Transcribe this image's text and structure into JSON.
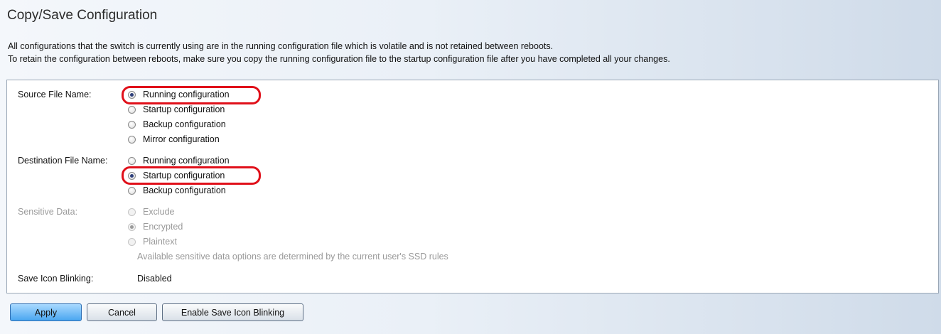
{
  "page": {
    "title": "Copy/Save Configuration",
    "intro_line1": "All configurations that the switch is currently using are in the running configuration file which is volatile and is not retained between reboots.",
    "intro_line2": "To retain the configuration between reboots, make sure you copy the running configuration file to the startup configuration file after you have completed all your changes."
  },
  "source": {
    "label": "Source File Name:",
    "options": [
      "Running configuration",
      "Startup configuration",
      "Backup configuration",
      "Mirror configuration"
    ],
    "selected": "Running configuration"
  },
  "destination": {
    "label": "Destination File Name:",
    "options": [
      "Running configuration",
      "Startup configuration",
      "Backup configuration"
    ],
    "selected": "Startup configuration"
  },
  "sensitive": {
    "label": "Sensitive Data:",
    "options": [
      "Exclude",
      "Encrypted",
      "Plaintext"
    ],
    "selected": "Encrypted",
    "note": "Available sensitive data options are determined by the current user's SSD rules"
  },
  "blink": {
    "label": "Save Icon Blinking:",
    "value": "Disabled"
  },
  "buttons": {
    "apply": "Apply",
    "cancel": "Cancel",
    "enable_blink": "Enable Save Icon Blinking"
  },
  "colors": {
    "highlight": "#e0101a",
    "apply_button": "#4aa6f0"
  }
}
